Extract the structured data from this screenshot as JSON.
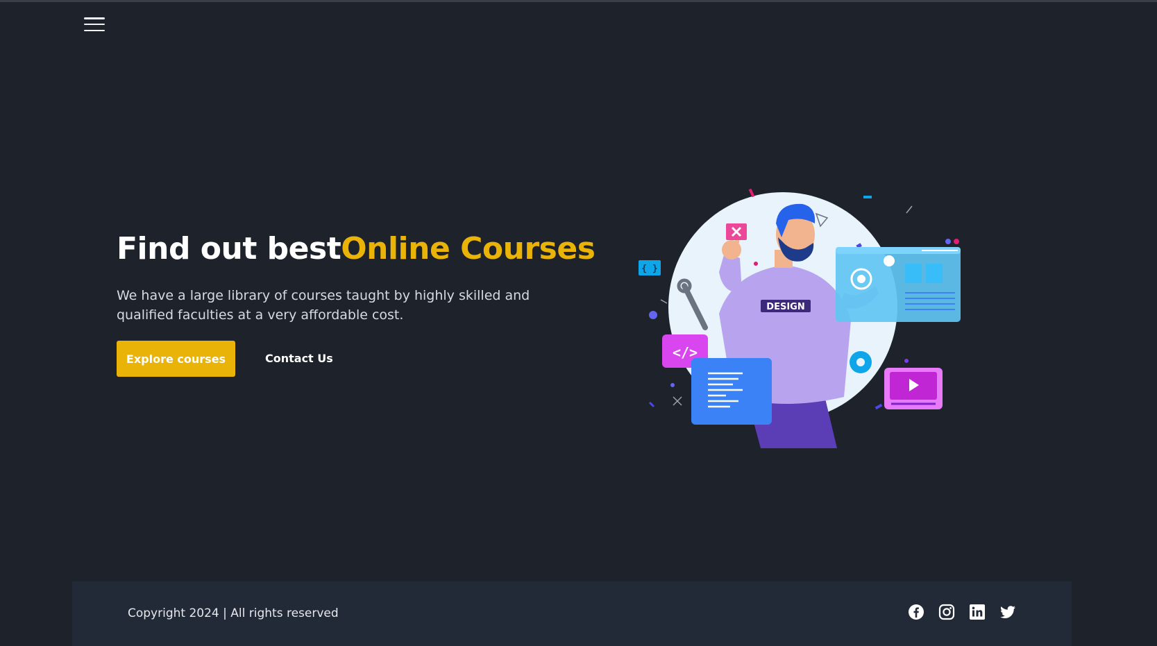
{
  "hero": {
    "title_plain": "Find out best",
    "title_accent": "Online Courses",
    "description": "We have a large library of courses taught by highly skilled and qualified faculties at a very affordable cost.",
    "primary_button": "Explore courses",
    "secondary_button": "Contact Us",
    "illustration_badge": "DESIGN"
  },
  "footer": {
    "copyright": "Copyright 2024 | All rights reserved",
    "social_icons": [
      "facebook-icon",
      "instagram-icon",
      "linkedin-icon",
      "twitter-icon"
    ]
  },
  "colors": {
    "background": "#1d222b",
    "accent": "#eab308",
    "footer_background": "#222a38"
  }
}
